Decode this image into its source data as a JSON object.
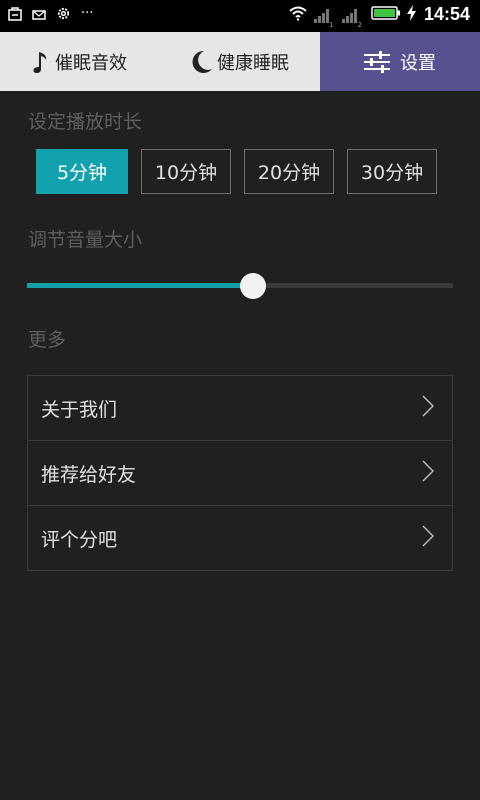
{
  "status_bar": {
    "time": "14:54",
    "sim1_label": "1",
    "sim2_label": "2",
    "more_dots": "···"
  },
  "tabs": [
    {
      "label": "催眠音效",
      "icon": "music-note-icon"
    },
    {
      "label": "健康睡眠",
      "icon": "moon-icon"
    },
    {
      "label": "设置",
      "icon": "settings-sliders-icon",
      "active": true
    }
  ],
  "duration": {
    "title": "设定播放时长",
    "options": [
      "5分钟",
      "10分钟",
      "20分钟",
      "30分钟"
    ],
    "selected_index": 0
  },
  "volume": {
    "title": "调节音量大小",
    "level": 0.53
  },
  "more": {
    "title": "更多",
    "items": [
      "关于我们",
      "推荐给好友",
      "评个分吧"
    ]
  },
  "colors": {
    "accent": "#12a2ad",
    "active_tab": "#56528f",
    "background": "#202020"
  }
}
